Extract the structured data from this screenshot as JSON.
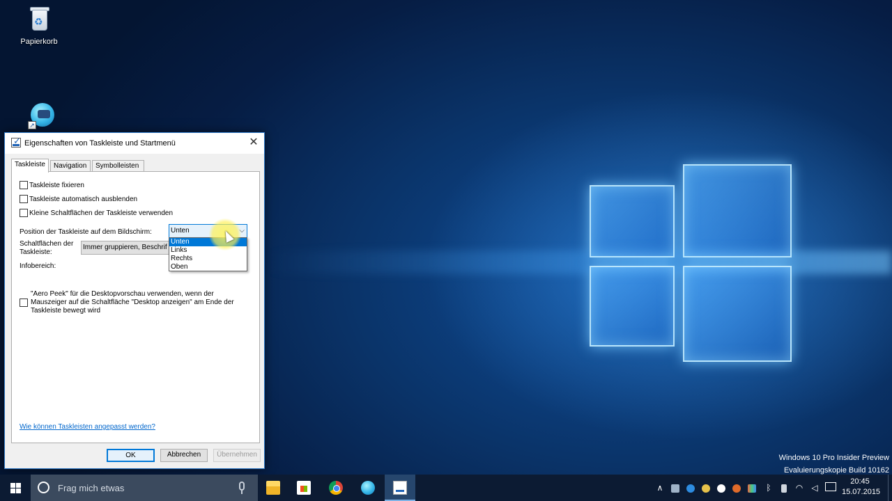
{
  "desktop": {
    "icons": [
      {
        "label": "Papierkorb"
      },
      {
        "label": ""
      }
    ],
    "watermark": {
      "line1": "Windows 10 Pro Insider Preview",
      "line2": "Evaluierungskopie Build 10162"
    }
  },
  "dialog": {
    "title": "Eigenschaften von Taskleiste und Startmenü",
    "close_glyph": "✕",
    "tabs": [
      {
        "label": "Taskleiste",
        "active": true
      },
      {
        "label": "Navigation",
        "active": false
      },
      {
        "label": "Symbolleisten",
        "active": false
      }
    ],
    "checkboxes": [
      {
        "label": "Taskleiste fixieren",
        "checked": false
      },
      {
        "label": "Taskleiste automatisch ausblenden",
        "checked": false
      },
      {
        "label": "Kleine Schaltflächen der Taskleiste verwenden",
        "checked": false
      }
    ],
    "position": {
      "label": "Position der Taskleiste auf dem Bildschirm:",
      "value": "Unten",
      "options": [
        "Unten",
        "Links",
        "Rechts",
        "Oben"
      ],
      "highlighted": "Unten"
    },
    "buttons_group": {
      "label_line1": "Schaltflächen der",
      "label_line2": "Taskleiste:",
      "value": "Immer gruppieren, Beschrif"
    },
    "info_label": "Infobereich:",
    "aero_peek": {
      "text": "\"Aero Peek\" für die Desktopvorschau verwenden, wenn der Mauszeiger auf die Schaltfläche \"Desktop anzeigen\" am Ende der Taskleiste bewegt wird",
      "checked": false
    },
    "help_link": "Wie können Taskleisten angepasst werden?",
    "actions": {
      "ok": "OK",
      "cancel": "Abbrechen",
      "apply": "Übernehmen"
    }
  },
  "taskbar": {
    "search_placeholder": "Frag mich etwas",
    "apps": [
      {
        "icon": "file-explorer-icon"
      },
      {
        "icon": "store-icon"
      },
      {
        "icon": "chrome-icon"
      },
      {
        "icon": "camcorder-app-icon"
      },
      {
        "icon": "taskbar-settings-icon",
        "active": true
      }
    ],
    "tray": {
      "chevron": "∧",
      "time": "20:45",
      "date": "15.07.2015"
    }
  }
}
